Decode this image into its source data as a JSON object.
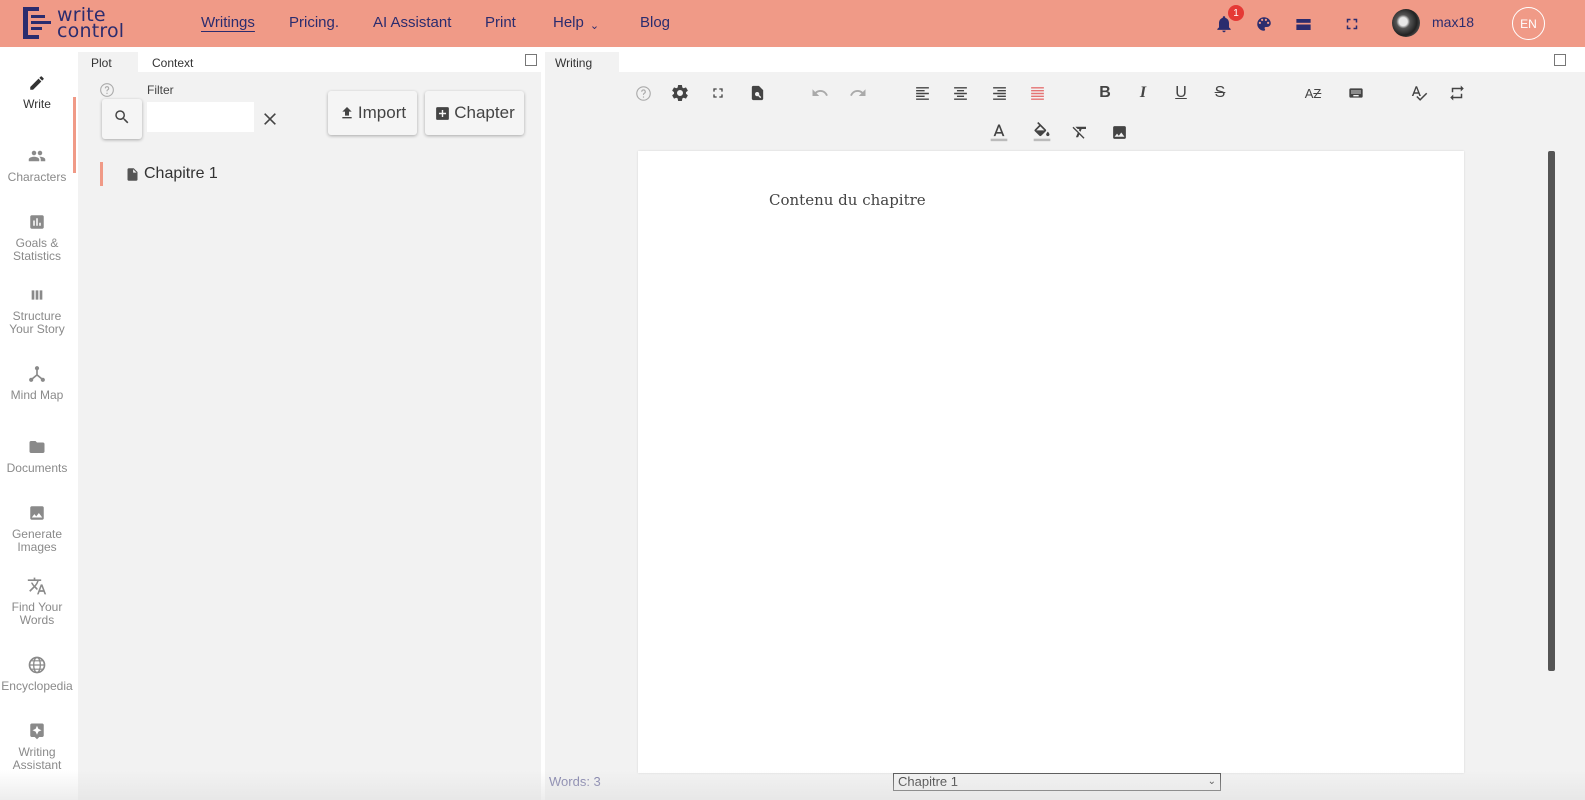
{
  "app": {
    "logo_line1": "write",
    "logo_line2": "control"
  },
  "nav": {
    "items": [
      {
        "label": "Writings",
        "active": true
      },
      {
        "label": "Pricing.",
        "active": false
      },
      {
        "label": "AI Assistant",
        "active": false
      },
      {
        "label": "Print",
        "active": false
      },
      {
        "label": "Help",
        "active": false
      },
      {
        "label": "Blog",
        "active": false
      }
    ]
  },
  "header": {
    "notification_count": "1",
    "username": "max18",
    "language": "EN"
  },
  "rail": {
    "items": [
      {
        "label": "Write",
        "icon": "pencil-icon",
        "active": true
      },
      {
        "label": "Characters",
        "icon": "people-icon"
      },
      {
        "label": "Goals & Statistics",
        "icon": "bar-chart-icon"
      },
      {
        "label": "Structure Your Story",
        "icon": "columns-icon"
      },
      {
        "label": "Mind Map",
        "icon": "mind-map-icon"
      },
      {
        "label": "Documents",
        "icon": "folder-icon"
      },
      {
        "label": "Generate Images",
        "icon": "image-icon"
      },
      {
        "label": "Find Your Words",
        "icon": "translate-icon"
      },
      {
        "label": "Encyclopedia",
        "icon": "globe-icon"
      },
      {
        "label": "Writing Assistant",
        "icon": "sparkle-icon"
      }
    ]
  },
  "plot_panel": {
    "tabs": [
      "Plot",
      "Context"
    ],
    "filter_label": "Filter",
    "search_value": "",
    "import_label": "Import",
    "chapter_button_label": "Chapter",
    "chapters": [
      "Chapitre 1"
    ]
  },
  "writing_panel": {
    "tab": "Writing",
    "content": "Contenu du chapitre",
    "word_count": "Words: 3",
    "selected_chapter": "Chapitre 1"
  },
  "colors": {
    "topbar": "#f09a87",
    "brand_text": "#2b2c6e",
    "active_accent": "#f09a87",
    "panel_bg": "#f2f2f2",
    "justify_active": "#e57373"
  }
}
